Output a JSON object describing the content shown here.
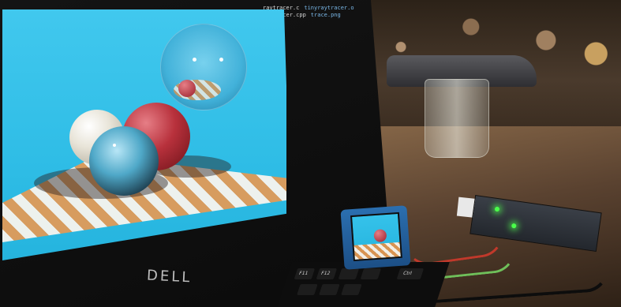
{
  "photo": {
    "terminal": {
      "row1": {
        "left": "raytracer.c",
        "right": "tinyraytracer.o"
      },
      "row2": {
        "left": "raytracer.cpp",
        "right": "trace.png"
      }
    },
    "laptop_logo": "DELL",
    "keys": [
      "F11",
      "F12",
      "Ctrl"
    ],
    "colors": {
      "sky": "#2fbde6",
      "checker_light": "#f7f4ee",
      "checker_dark": "#e09a58",
      "sphere_red": "#b8313c",
      "sphere_ivory": "#e8e4d8",
      "led_green": "#4aff4a",
      "module_blue": "#1c4f86"
    }
  }
}
